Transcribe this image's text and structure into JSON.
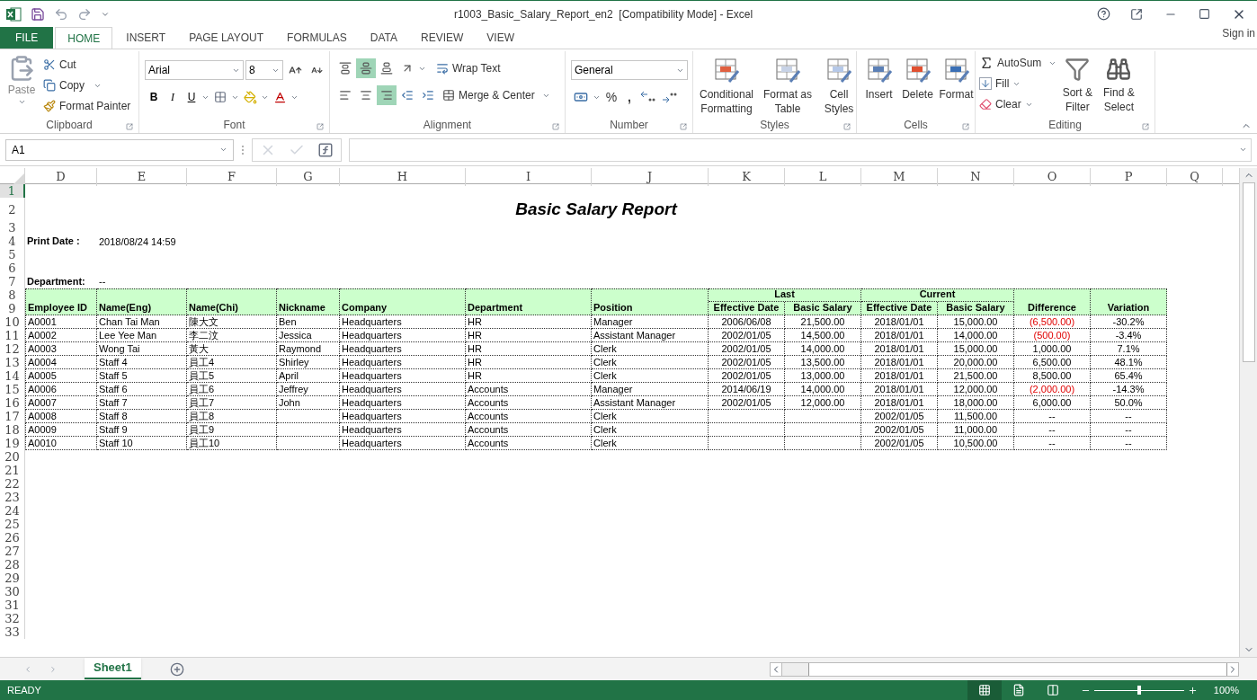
{
  "window": {
    "title": "r1003_Basic_Salary_Report_en2  [Compatibility Mode] - Excel",
    "sign_in": "Sign in"
  },
  "ribbon_tabs": [
    {
      "label": "FILE",
      "kind": "file",
      "selected": false
    },
    {
      "label": "HOME",
      "kind": "tab",
      "selected": true
    },
    {
      "label": "INSERT",
      "kind": "tab",
      "selected": false
    },
    {
      "label": "PAGE LAYOUT",
      "kind": "tab",
      "selected": false
    },
    {
      "label": "FORMULAS",
      "kind": "tab",
      "selected": false
    },
    {
      "label": "DATA",
      "kind": "tab",
      "selected": false
    },
    {
      "label": "REVIEW",
      "kind": "tab",
      "selected": false
    },
    {
      "label": "VIEW",
      "kind": "tab",
      "selected": false
    }
  ],
  "ribbon": {
    "clipboard": {
      "label": "Clipboard",
      "paste": "Paste",
      "cut": "Cut",
      "copy": "Copy",
      "format_painter": "Format Painter"
    },
    "font": {
      "label": "Font",
      "name": "Arial",
      "size": "8",
      "bold": "B",
      "italic": "I",
      "underline": "U"
    },
    "alignment": {
      "label": "Alignment",
      "vertical": [
        {
          "selected": false
        },
        {
          "selected": true
        },
        {
          "selected": false
        }
      ],
      "horizontal": [
        {
          "selected": false
        },
        {
          "selected": false
        },
        {
          "selected": true
        }
      ],
      "wrap_text": "Wrap Text",
      "merge_center": "Merge & Center"
    },
    "number": {
      "label": "Number",
      "format": "General",
      "percent": "%",
      "comma": ","
    },
    "styles": {
      "label": "Styles",
      "items": [
        "Conditional Formatting",
        "Format as Table",
        "Cell Styles"
      ]
    },
    "cells": {
      "label": "Cells",
      "items": [
        "Insert",
        "Delete",
        "Format"
      ]
    },
    "editing": {
      "label": "Editing",
      "autosum": "AutoSum",
      "fill": "Fill",
      "clear": "Clear",
      "sort_filter": "Sort & Filter",
      "find_select": "Find & Select"
    }
  },
  "formula_bar": {
    "name_box": "A1"
  },
  "sheet": {
    "columns": [
      "D",
      "E",
      "F",
      "G",
      "H",
      "I",
      "J",
      "K",
      "L",
      "M",
      "N",
      "O",
      "P",
      "Q"
    ],
    "row_headers": [
      {
        "label": "1",
        "selected": true
      },
      {
        "label": "2",
        "selected": false
      },
      {
        "label": "3",
        "selected": false
      },
      {
        "label": "4",
        "selected": false
      },
      {
        "label": "5",
        "selected": false
      },
      {
        "label": "6",
        "selected": false
      },
      {
        "label": "7",
        "selected": false
      },
      {
        "label": "8",
        "selected": false
      },
      {
        "label": "9",
        "selected": false
      },
      {
        "label": "10",
        "selected": false
      },
      {
        "label": "11",
        "selected": false
      },
      {
        "label": "12",
        "selected": false
      },
      {
        "label": "13",
        "selected": false
      },
      {
        "label": "14",
        "selected": false
      },
      {
        "label": "15",
        "selected": false
      },
      {
        "label": "16",
        "selected": false
      },
      {
        "label": "17",
        "selected": false
      },
      {
        "label": "18",
        "selected": false
      },
      {
        "label": "19",
        "selected": false
      },
      {
        "label": "20",
        "selected": false
      },
      {
        "label": "21",
        "selected": false
      },
      {
        "label": "22",
        "selected": false
      },
      {
        "label": "23",
        "selected": false
      },
      {
        "label": "24",
        "selected": false
      },
      {
        "label": "25",
        "selected": false
      },
      {
        "label": "26",
        "selected": false
      },
      {
        "label": "27",
        "selected": false
      },
      {
        "label": "28",
        "selected": false
      },
      {
        "label": "29",
        "selected": false
      },
      {
        "label": "30",
        "selected": false
      },
      {
        "label": "31",
        "selected": false
      },
      {
        "label": "32",
        "selected": false
      },
      {
        "label": "33",
        "selected": false
      }
    ]
  },
  "report": {
    "title": "Basic Salary Report",
    "print_date_label": "Print Date :",
    "print_date": "2018/08/24 14:59",
    "department_label": "Department:",
    "department": "--",
    "header_groups": [
      "Last",
      "Current"
    ],
    "columns": [
      "Employee ID",
      "Name(Eng)",
      "Name(Chi)",
      "Nickname",
      "Company",
      "Department",
      "Position",
      "Effective Date",
      "Basic Salary",
      "Effective Date",
      "Basic Salary",
      "Difference",
      "Variation"
    ],
    "rows": [
      {
        "cells": [
          "A0001",
          "Chan Tai Man",
          "陳大文",
          "Ben",
          "Headquarters",
          "HR",
          "Manager",
          "2006/06/08",
          "21,500.00",
          "2018/01/01",
          "15,000.00",
          "(6,500.00)",
          "-30.2%"
        ],
        "negative": true
      },
      {
        "cells": [
          "A0002",
          "Lee Yee Man",
          "李二汶",
          "Jessica",
          "Headquarters",
          "HR",
          "Assistant Manager",
          "2002/01/05",
          "14,500.00",
          "2018/01/01",
          "14,000.00",
          "(500.00)",
          "-3.4%"
        ],
        "negative": true
      },
      {
        "cells": [
          "A0003",
          "Wong Tai",
          "黃大",
          "Raymond",
          "Headquarters",
          "HR",
          "Clerk",
          "2002/01/05",
          "14,000.00",
          "2018/01/01",
          "15,000.00",
          "1,000.00",
          "7.1%"
        ],
        "negative": false
      },
      {
        "cells": [
          "A0004",
          "Staff 4",
          "員工4",
          "Shirley",
          "Headquarters",
          "HR",
          "Clerk",
          "2002/01/05",
          "13,500.00",
          "2018/01/01",
          "20,000.00",
          "6,500.00",
          "48.1%"
        ],
        "negative": false
      },
      {
        "cells": [
          "A0005",
          "Staff 5",
          "員工5",
          "April",
          "Headquarters",
          "HR",
          "Clerk",
          "2002/01/05",
          "13,000.00",
          "2018/01/01",
          "21,500.00",
          "8,500.00",
          "65.4%"
        ],
        "negative": false
      },
      {
        "cells": [
          "A0006",
          "Staff 6",
          "員工6",
          "Jeffrey",
          "Headquarters",
          "Accounts",
          "Manager",
          "2014/06/19",
          "14,000.00",
          "2018/01/01",
          "12,000.00",
          "(2,000.00)",
          "-14.3%"
        ],
        "negative": true
      },
      {
        "cells": [
          "A0007",
          "Staff 7",
          "員工7",
          "John",
          "Headquarters",
          "Accounts",
          "Assistant Manager",
          "2002/01/05",
          "12,000.00",
          "2018/01/01",
          "18,000.00",
          "6,000.00",
          "50.0%"
        ],
        "negative": false
      },
      {
        "cells": [
          "A0008",
          "Staff 8",
          "員工8",
          "",
          "Headquarters",
          "Accounts",
          "Clerk",
          "",
          "",
          "2002/01/05",
          "11,500.00",
          "--",
          "--"
        ],
        "negative": false
      },
      {
        "cells": [
          "A0009",
          "Staff 9",
          "員工9",
          "",
          "Headquarters",
          "Accounts",
          "Clerk",
          "",
          "",
          "2002/01/05",
          "11,000.00",
          "--",
          "--"
        ],
        "negative": false
      },
      {
        "cells": [
          "A0010",
          "Staff 10",
          "員工10",
          "",
          "Headquarters",
          "Accounts",
          "Clerk",
          "",
          "",
          "2002/01/05",
          "10,500.00",
          "--",
          "--"
        ],
        "negative": false
      }
    ]
  },
  "sheet_tabs": [
    {
      "label": "Sheet1",
      "selected": true
    }
  ],
  "status_bar": {
    "status": "READY",
    "views": [
      {
        "selected": true
      },
      {
        "selected": false
      },
      {
        "selected": false
      }
    ],
    "zoom": "100%",
    "zoom_level": {
      "level": 0.5
    }
  }
}
